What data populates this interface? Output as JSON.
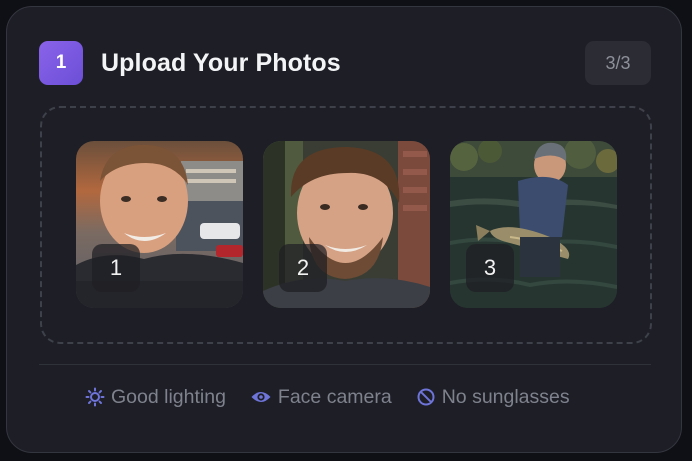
{
  "step": {
    "number": "1",
    "title": "Upload Your Photos",
    "counter": "3/3"
  },
  "photos": [
    {
      "label": "1"
    },
    {
      "label": "2"
    },
    {
      "label": "3"
    }
  ],
  "tips": [
    {
      "icon": "sun-icon",
      "label": "Good lighting"
    },
    {
      "icon": "eye-icon",
      "label": "Face camera"
    },
    {
      "icon": "no-symbol-icon",
      "label": "No sunglasses"
    }
  ],
  "colors": {
    "accent": "#7b5ae3",
    "tip_icon": "#6e74d8",
    "card_bg": "#1d1e26"
  }
}
